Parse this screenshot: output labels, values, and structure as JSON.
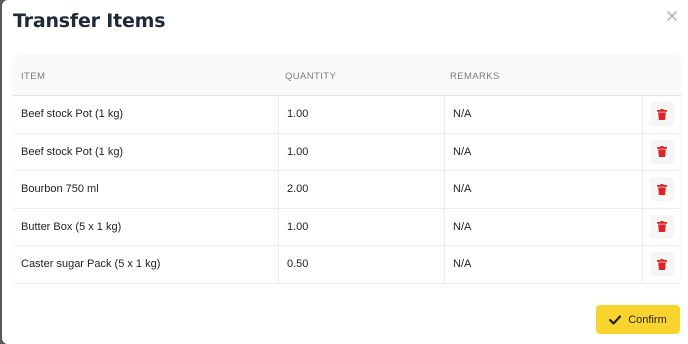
{
  "modal": {
    "title": "Transfer Items",
    "close_icon": "close-icon",
    "confirm_label": "Confirm"
  },
  "table": {
    "headers": {
      "item": "ITEM",
      "quantity": "QUANTITY",
      "remarks": "REMARKS"
    },
    "rows": [
      {
        "item": "Beef stock Pot (1 kg)",
        "quantity": "1.00",
        "remarks": "N/A"
      },
      {
        "item": "Beef stock Pot (1 kg)",
        "quantity": "1.00",
        "remarks": "N/A"
      },
      {
        "item": "Bourbon 750 ml",
        "quantity": "2.00",
        "remarks": "N/A"
      },
      {
        "item": "Butter Box (5 x 1 kg)",
        "quantity": "1.00",
        "remarks": "N/A"
      },
      {
        "item": "Caster sugar Pack (5 x 1 kg)",
        "quantity": "0.50",
        "remarks": "N/A"
      }
    ]
  },
  "colors": {
    "accent": "#f9d42c",
    "delete": "#e02424",
    "title": "#1f2a37"
  }
}
